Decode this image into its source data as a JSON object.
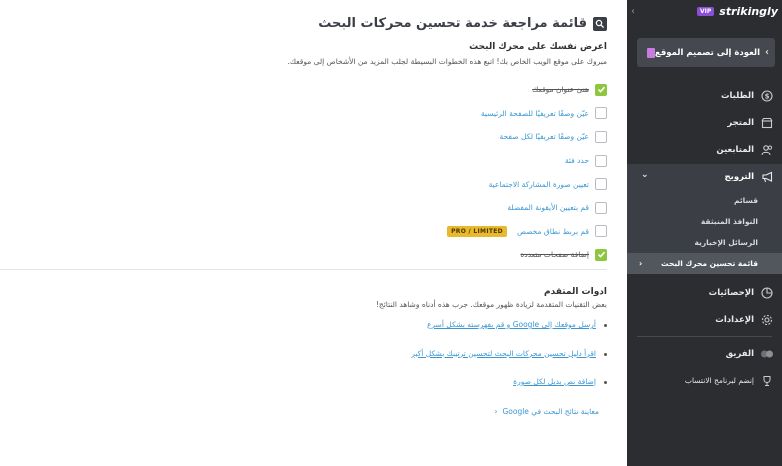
{
  "main": {
    "title": "قائمة مراجعة خدمة تحسين محركات البحث",
    "intro": {
      "heading": "اعرض نفسك على محرك البحث",
      "desc": "مبروك على موقع الويب الخاص بك! اتبع هذه الخطوات البسيطة لجلب المزيد من الأشخاص إلى موقعك."
    },
    "checklist": [
      {
        "label": "هنئ عنوان موقعك",
        "done": true
      },
      {
        "label": "عيّن وصفًا تعريفيًا للصفحة الرئيسية",
        "done": false
      },
      {
        "label": "عيّن وصفًا تعريفيًا لكل صفحة",
        "done": false
      },
      {
        "label": "حدد فئة",
        "done": false
      },
      {
        "label": "تعيين صورة المشاركة الاجتماعية",
        "done": false
      },
      {
        "label": "قم بتعيين الأيقونة المفضلة",
        "done": false
      },
      {
        "label": "قم بربط نطاق مخصص",
        "done": false,
        "badge": "PRO / LIMITED"
      },
      {
        "label": "إضافة صفحات متعددة",
        "done": true
      }
    ],
    "tools": {
      "heading": "ادوات المتقدم",
      "desc": "بعض التقنيات المتقدمة لزيادة ظهور موقعك. جرب هذه أدناه وشاهد النتائج!",
      "links": [
        "أرسل موقعك إلى Google و قم بفهرسته بشكل أسرع",
        "اقرأ دليل تحسين محركات البحث لتحسين ترتيبك بشكل أكبر",
        "إضافة نص بديل لكل صورة"
      ],
      "preview": "معاينة نتائج البحث في Google"
    }
  },
  "sidebar": {
    "brand": "strikingly",
    "vip": "VIP",
    "back_label": "العودة إلى تصميم الموقع",
    "nav": [
      {
        "label": "الطلبات",
        "icon": "dollar-icon"
      },
      {
        "label": "المتجر",
        "icon": "store-icon"
      },
      {
        "label": "المتابعين",
        "icon": "followers-icon"
      }
    ],
    "promotion": {
      "label": "الترويج",
      "icon": "megaphone-icon",
      "items": [
        {
          "label": "قسائم",
          "active": false
        },
        {
          "label": "النوافذ المنبثقة",
          "active": false
        },
        {
          "label": "الرسائل الإخبارية",
          "active": false
        },
        {
          "label": "قائمة تحسين محرك البحث",
          "active": true
        }
      ]
    },
    "nav2": [
      {
        "label": "الإحصائيات",
        "icon": "pie-chart-icon"
      },
      {
        "label": "الإعدادات",
        "icon": "gear-icon"
      }
    ],
    "nav3": [
      {
        "label": "الفريق",
        "icon": "team-icon"
      },
      {
        "label": "إنضم لبرنامج الانتساب",
        "icon": "trophy-icon"
      }
    ]
  },
  "colors": {
    "accent": "#3a97d4",
    "check": "#8dc63f",
    "sidebar_bg": "#2b2d31",
    "badge": "#e8b82e"
  }
}
